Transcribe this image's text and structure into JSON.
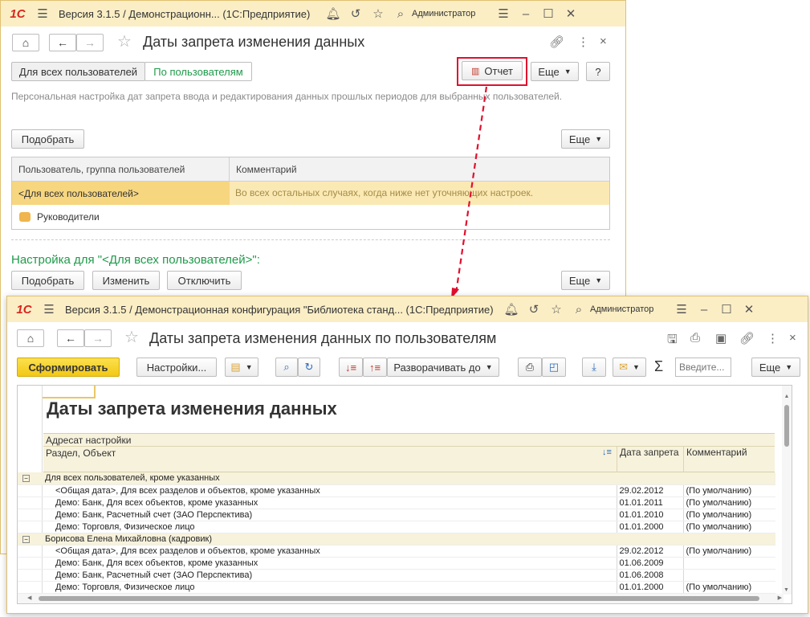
{
  "back_window": {
    "title": "Версия 3.1.5 / Демонстрационн... (1С:Предприятие)",
    "user": "Администратор",
    "page_title": "Даты запрета изменения данных",
    "toggle": [
      "Для всех пользователей",
      "По пользователям"
    ],
    "report_button": "Отчет",
    "more_button": "Еще",
    "help_button": "?",
    "description": "Персональная настройка дат запрета ввода и редактирования данных прошлых периодов для выбранных пользователей.",
    "pick_button": "Подобрать",
    "table_headers": [
      "Пользователь, группа пользователей",
      "Комментарий"
    ],
    "rows": [
      {
        "user": "<Для всех пользователей>",
        "comment": "Во всех остальных случаях, когда ниже нет уточняющих настроек."
      },
      {
        "user": "Руководители",
        "comment": ""
      }
    ],
    "settings_title": "Настройка для \"<Для всех пользователей>\":",
    "bottom_buttons": [
      "Подобрать",
      "Изменить",
      "Отключить"
    ]
  },
  "front_window": {
    "title": "Версия 3.1.5 / Демонстрационная конфигурация \"Библиотека станд... (1С:Предприятие)",
    "user": "Администратор",
    "page_title": "Даты запрета изменения данных по пользователям",
    "generate_button": "Сформировать",
    "settings_button": "Настройки...",
    "expand_button": "Разворачивать до",
    "search_placeholder": "Введите...",
    "more_button": "Еще",
    "sigma": "Σ",
    "report": {
      "title": "Даты запрета изменения данных",
      "header_row1": "Адресат настройки",
      "col_section": "Раздел, Объект",
      "col_date": "Дата запрета",
      "col_comment": "Комментарий",
      "groups": [
        {
          "name": "Для всех пользователей, кроме указанных",
          "rows": [
            {
              "obj": "<Общая дата>, Для всех разделов и объектов, кроме указанных",
              "date": "29.02.2012",
              "comment": "(По умолчанию)"
            },
            {
              "obj": "Демо: Банк, Для всех объектов, кроме указанных",
              "date": "01.01.2011",
              "comment": "(По умолчанию)"
            },
            {
              "obj": "Демо: Банк, Расчетный счет (ЗАО Перспектива)",
              "date": "01.01.2010",
              "comment": "(По умолчанию)"
            },
            {
              "obj": "Демо: Торговля, Физическое лицо",
              "date": "01.01.2000",
              "comment": "(По умолчанию)"
            }
          ]
        },
        {
          "name": "Борисова Елена Михайловна (кадровик)",
          "rows": [
            {
              "obj": "<Общая дата>, Для всех разделов и объектов, кроме указанных",
              "date": "29.02.2012",
              "comment": "(По умолчанию)"
            },
            {
              "obj": "Демо: Банк, Для всех объектов, кроме указанных",
              "date": "01.06.2009",
              "comment": ""
            },
            {
              "obj": "Демо: Банк, Расчетный счет (ЗАО Перспектива)",
              "date": "01.06.2008",
              "comment": ""
            },
            {
              "obj": "Демо: Торговля, Физическое лицо",
              "date": "01.01.2000",
              "comment": "(По умолчанию)"
            }
          ]
        }
      ]
    }
  },
  "colors": {
    "accent_red": "#e0102f",
    "green": "#1f9a4a",
    "yellow_btn": "#f6d22c",
    "titlebar": "#fbeec5"
  }
}
